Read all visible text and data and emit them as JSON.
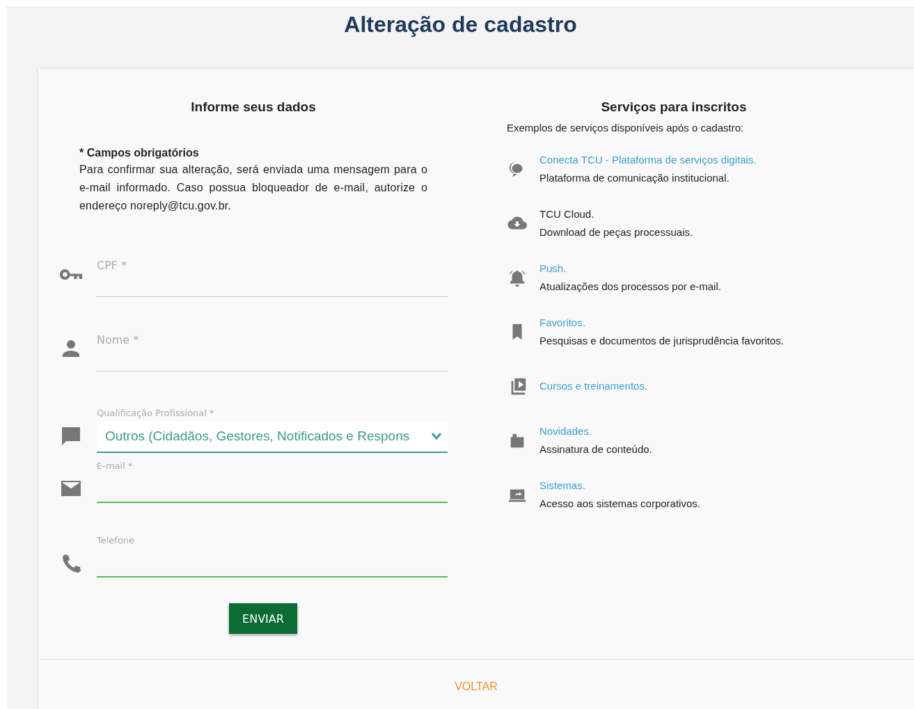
{
  "title": "Alteração de cadastro",
  "form": {
    "heading": "Informe seus dados",
    "required_note": "* Campos obrigatórios",
    "info": "Para confirmar sua alteração, será enviada uma mensagem para o e-mail informado. Caso possua bloqueador de e-mail, autorize o endereço noreply@tcu.gov.br.",
    "fields": [
      {
        "kind": "text",
        "label": "CPF *",
        "active": false
      },
      {
        "kind": "text",
        "label": "Nome *",
        "active": false
      },
      {
        "kind": "select",
        "label": "Qualificação Profissional *",
        "value": "Outros (Cidadãos, Gestores, Notificados e Respons",
        "active": true
      },
      {
        "kind": "text",
        "label": "E-mail *",
        "active": true
      },
      {
        "kind": "text",
        "label": "Telefone",
        "active": true
      }
    ],
    "submit": "ENVIAR"
  },
  "services": {
    "heading": "Serviços para inscritos",
    "subtitle": "Exemplos de serviços disponíveis após o cadastro:",
    "items": [
      {
        "title": "Conecta TCU - Plataforma de serviços digitais.",
        "link": true,
        "description": "Plataforma de comunicação institucional."
      },
      {
        "title": "TCU Cloud.",
        "link": false,
        "description": "Download de peças processuais."
      },
      {
        "title": "Push.",
        "link": true,
        "description": "Atualizações dos processos por e-mail."
      },
      {
        "title": "Favoritos.",
        "link": true,
        "description": "Pesquisas e documentos de jurisprudência favoritos."
      },
      {
        "title": "Cursos e treinamentos.",
        "link": true
      },
      {
        "title": "Novidades.",
        "link": true,
        "description": "Assinatura de conteúdo."
      },
      {
        "title": "Sistemas.",
        "link": true,
        "description": "Acesso aos sistemas corporativos."
      }
    ]
  },
  "footer": {
    "back": "VOLTAR"
  }
}
